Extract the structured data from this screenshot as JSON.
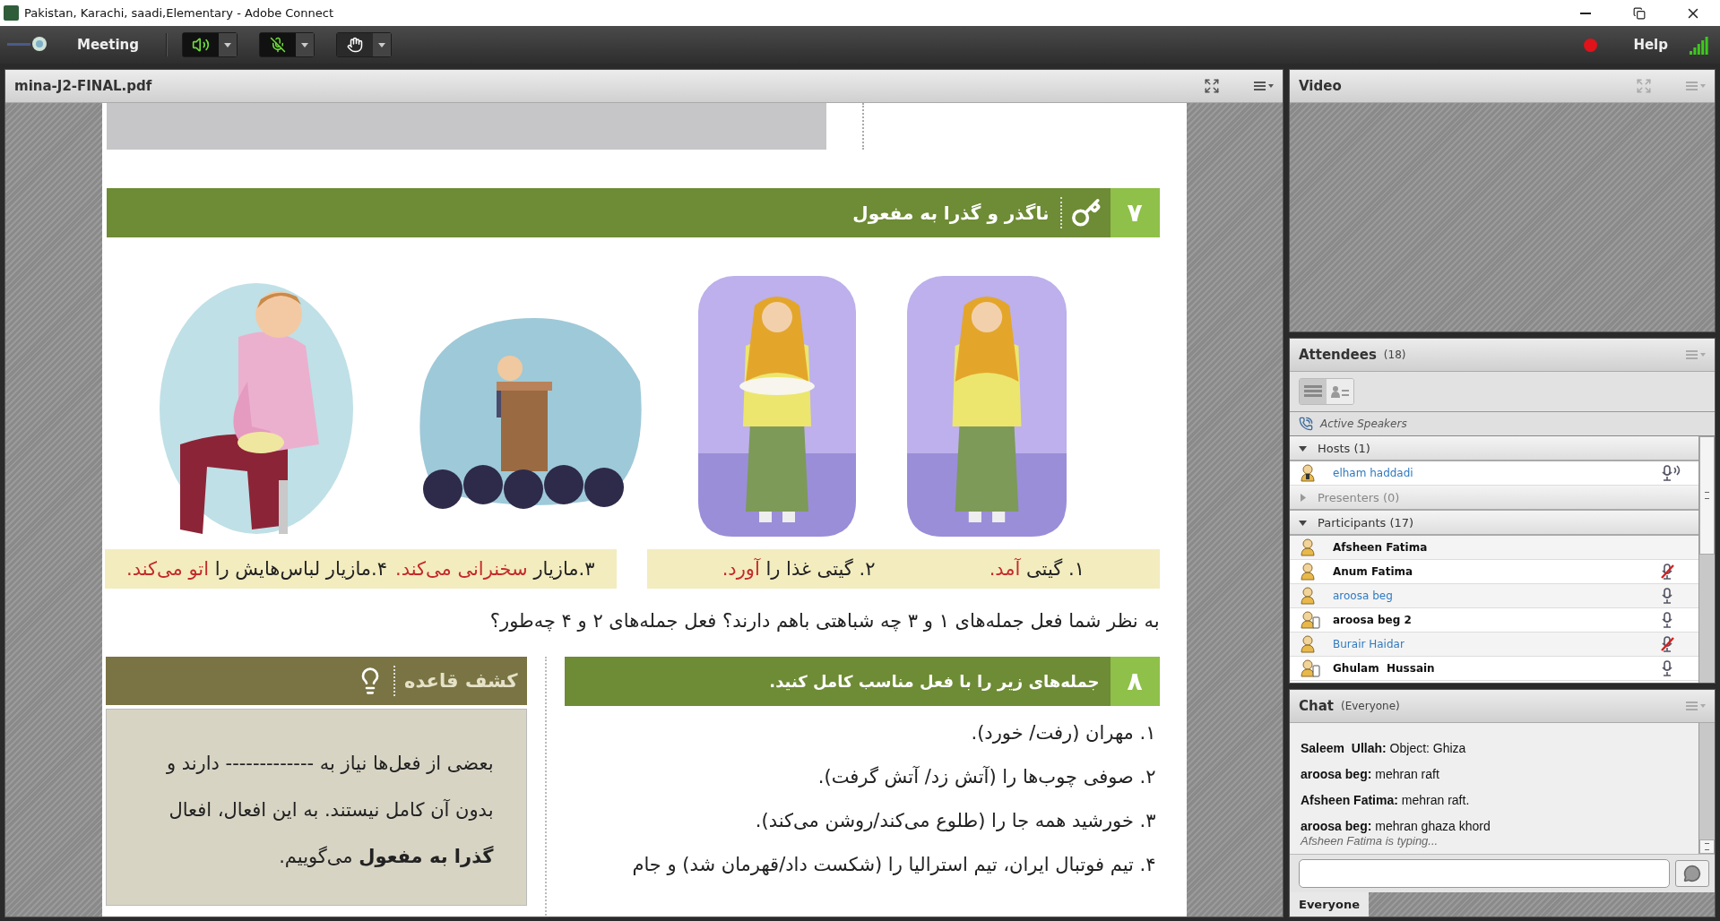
{
  "window": {
    "title": "Pakistan, Karachi, saadi,Elementary - Adobe Connect"
  },
  "menu_bar": {
    "menu": "Meeting",
    "help": "Help",
    "recording": true,
    "toolbar_buttons": [
      {
        "kind": "speaker"
      },
      {
        "kind": "microphone"
      },
      {
        "kind": "raise-hand"
      }
    ]
  },
  "document_pod": {
    "title": "mina-J2-FINAL.pdf",
    "page": {
      "section_7": {
        "number": "۷",
        "title": "ناگذر و گذرا به مفعول"
      },
      "caption_boxes": [
        {
          "captions": [
            {
              "parts": [
                {
                  "text": "۱. گیتی ",
                  "highlight": false
                },
                {
                  "text": "آمد.",
                  "highlight": true
                }
              ]
            },
            {
              "parts": [
                {
                  "text": "۲. گیتی غذا را ",
                  "highlight": false
                },
                {
                  "text": "آورد.",
                  "highlight": true
                }
              ]
            }
          ]
        },
        {
          "captions": [
            {
              "parts": [
                {
                  "text": "۳.مازیار ",
                  "highlight": false
                },
                {
                  "text": "سخنرانی می‌کند.",
                  "highlight": true
                }
              ]
            },
            {
              "parts": [
                {
                  "text": "۴.مازیار لباس‌هایش را ",
                  "highlight": false
                },
                {
                  "text": "اتو می‌کند.",
                  "highlight": true
                }
              ]
            }
          ]
        }
      ],
      "question": "به نظر شما فعل جمله‌های ۱ و ۳ چه شباهتی باهم دارند؟ فعل جمله‌های ۲ و ۴ چه‌طور؟",
      "section_8": {
        "number": "۸",
        "title": "جمله‌های زیر را با فعل مناسب کامل کنید.",
        "items": [
          "۱. مهران (رفت/ خورد).",
          "۲. صوفی چوب‌ها را (آتش زد/ آتش گرفت).",
          "۳. خورشید همه جا را (طلوع می‌کند/روشن می‌کند).",
          "۴. تیم فوتبال ایران، تیم استرالیا را (شکست داد/قهرمان شد) و جام"
        ]
      },
      "rule_box": {
        "title": "کشف قاعده",
        "text": "بعضی از فعل‌ها نیاز به ------------- دارند و بدون آن کامل نیستند. به این افعال، افعال **گذرا به مفعول** می‌گوییم."
      }
    }
  },
  "video_pod": {
    "title": "Video"
  },
  "attendees_pod": {
    "title": "Attendees",
    "count": "(18)",
    "views": [
      {
        "kind": "list",
        "selected": true
      },
      {
        "kind": "cards",
        "selected": false
      }
    ],
    "active_speakers": "Active Speakers",
    "groups": [
      {
        "label": "Hosts (1)",
        "expanded": true,
        "members": [
          {
            "name": "elham haddadi",
            "kind": "host",
            "highlighted": true,
            "has_mic": true,
            "muted": false,
            "speaking": true
          }
        ]
      },
      {
        "label": "Presenters (0)",
        "expanded": false
      },
      {
        "label": "Participants (17)",
        "expanded": true,
        "members": [
          {
            "name": "Afsheen Fatima",
            "kind": "participant",
            "highlighted": false,
            "has_mic": false
          },
          {
            "name": "Anum Fatima",
            "kind": "participant",
            "highlighted": false,
            "has_mic": true,
            "muted": true,
            "speaking": false
          },
          {
            "name": "aroosa beg",
            "kind": "participant",
            "highlighted": true,
            "has_mic": true,
            "muted": false,
            "speaking": false
          },
          {
            "name": "aroosa beg 2",
            "kind": "phone",
            "highlighted": false,
            "has_mic": true,
            "muted": false,
            "speaking": false
          },
          {
            "name": "Burair Haidar",
            "kind": "participant",
            "highlighted": true,
            "has_mic": true,
            "muted": true,
            "speaking": false
          },
          {
            "name": "Ghulam  Hussain",
            "kind": "phone",
            "highlighted": false,
            "has_mic": true,
            "muted": false,
            "speaking": false
          }
        ]
      }
    ]
  },
  "chat_pod": {
    "title": "Chat",
    "audience": "(Everyone)",
    "messages": [
      {
        "sender": "Saleem  Ullah:",
        "text": "Object: Ghiza"
      },
      {
        "sender": "aroosa beg:",
        "text": "mehran raft"
      },
      {
        "sender": "Afsheen Fatima:",
        "text": "mehran raft."
      },
      {
        "sender": "aroosa beg:",
        "text": "mehran ghaza khord"
      }
    ],
    "typing": "Afsheen Fatima is typing...",
    "tabs": [
      {
        "label": "Everyone",
        "selected": true
      }
    ]
  }
}
